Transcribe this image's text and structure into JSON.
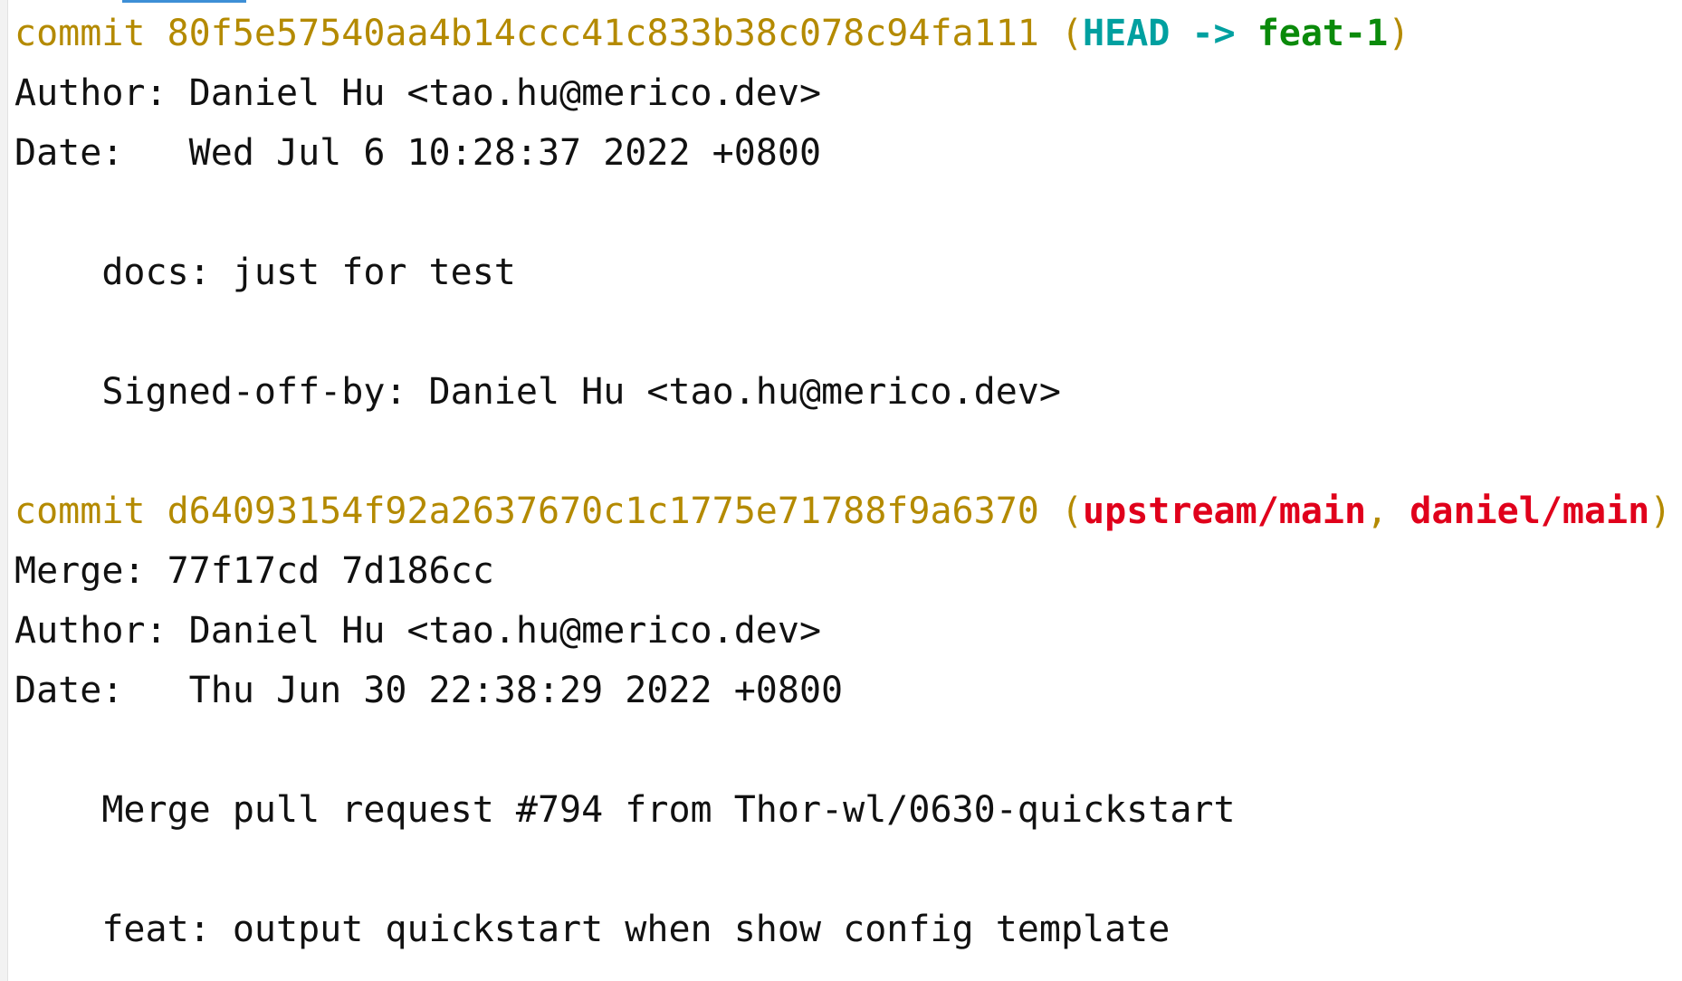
{
  "commits": [
    {
      "keyword": "commit ",
      "hash": "80f5e57540aa4b14ccc41c833b38c078c94fa111",
      "refs_open": " (",
      "head": "HEAD",
      "arrow": " -> ",
      "branch": "feat-1",
      "refs_close": ")",
      "author_line": "Author: Daniel Hu <tao.hu@merico.dev>",
      "date_line": "Date:   Wed Jul 6 10:28:37 2022 +0800",
      "message": [
        "    docs: just for test",
        "    Signed-off-by: Daniel Hu <tao.hu@merico.dev>"
      ]
    },
    {
      "keyword": "commit ",
      "hash": "d64093154f92a2637670c1c1775e71788f9a6370",
      "refs_open": " (",
      "ref1": "upstream/main",
      "sep": ", ",
      "ref2": "daniel/main",
      "refs_close": ")",
      "merge_line": "Merge: 77f17cd 7d186cc",
      "author_line": "Author: Daniel Hu <tao.hu@merico.dev>",
      "date_line": "Date:   Thu Jun 30 22:38:29 2022 +0800",
      "message": [
        "    Merge pull request #794 from Thor-wl/0630-quickstart",
        "    feat: output quickstart when show config template"
      ]
    }
  ],
  "colors": {
    "commit": "#b48a00",
    "head": "#00a0a0",
    "local_branch": "#0a8a0a",
    "remote_branch": "#e0001b",
    "text": "#111111",
    "background": "#ffffff"
  }
}
